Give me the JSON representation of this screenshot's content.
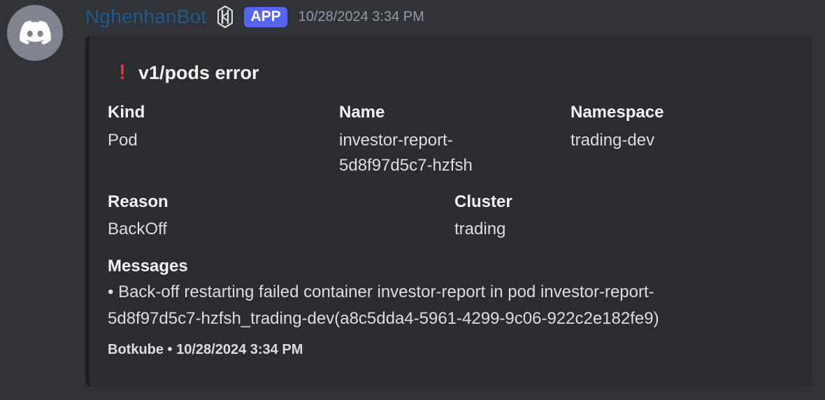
{
  "author": {
    "username": "NghenhanBot",
    "badge": "APP",
    "timestamp": "10/28/2024 3:34 PM"
  },
  "embed": {
    "title_icon": "exclamation-icon",
    "title": "v1/pods error",
    "fields": {
      "kind": {
        "name": "Kind",
        "value": "Pod"
      },
      "name": {
        "name": "Name",
        "value_line1": "investor-report-",
        "value_line2": "5d8f97d5c7-hzfsh"
      },
      "namespace": {
        "name": "Namespace",
        "value": "trading-dev"
      },
      "reason": {
        "name": "Reason",
        "value": "BackOff"
      },
      "cluster": {
        "name": "Cluster",
        "value": "trading"
      },
      "messages": {
        "name": "Messages",
        "value_line1": "• Back-off restarting failed container investor-report in pod investor-report-",
        "value_line2": "5d8f97d5c7-hzfsh_trading-dev(a8c5dda4-5961-4299-9c06-922c2e182fe9)"
      }
    },
    "footer": "Botkube • 10/28/2024 3:34 PM"
  },
  "colors": {
    "background": "#313338",
    "embed_background": "#2b2d31",
    "username": "#1e5a8c",
    "badge": "#5865f2",
    "exclamation": "#da373c"
  }
}
